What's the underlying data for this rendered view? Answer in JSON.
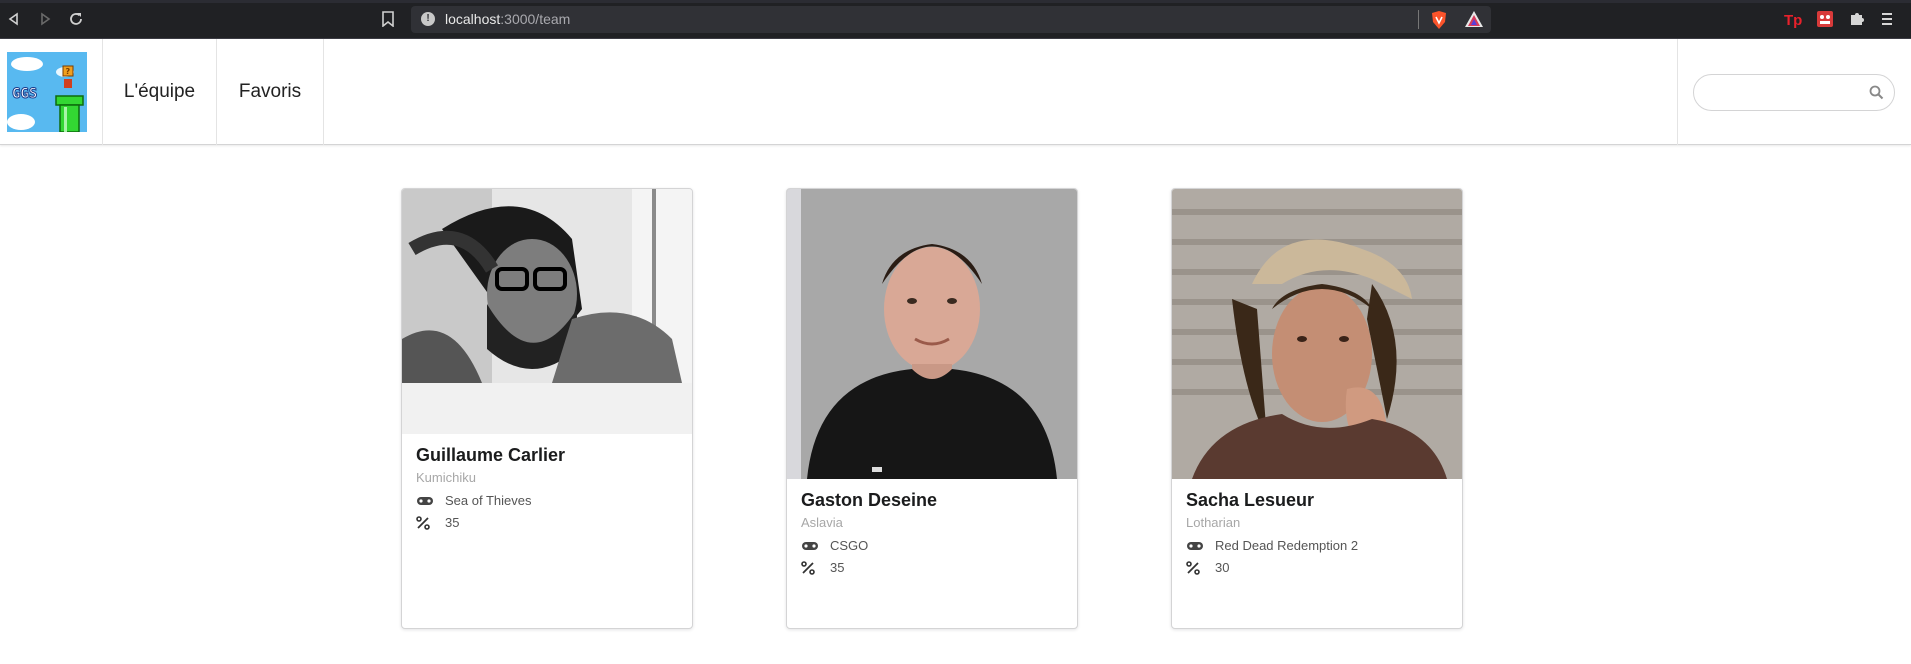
{
  "browser": {
    "url_host": "localhost",
    "url_path": ":3000/team"
  },
  "nav": {
    "items": [
      {
        "label": "L'équipe"
      },
      {
        "label": "Favoris"
      }
    ],
    "search_placeholder": ""
  },
  "team": [
    {
      "name": "Guillaume Carlier",
      "pseudo": "Kumichiku",
      "game": "Sea of Thieves",
      "percent": "35"
    },
    {
      "name": "Gaston Deseine",
      "pseudo": "Aslavia",
      "game": "CSGO",
      "percent": "35"
    },
    {
      "name": "Sacha Lesueur",
      "pseudo": "Lotharian",
      "game": "Red Dead Redemption 2",
      "percent": "30"
    }
  ],
  "colors": {
    "chrome_bg": "#202124",
    "urlbar_bg": "#303136",
    "card_border": "#d4d4d5",
    "pseudo_gray": "#a7a7a7"
  },
  "icons": {
    "game": "gamepad-icon",
    "percent": "percent-icon",
    "search": "search-icon"
  }
}
